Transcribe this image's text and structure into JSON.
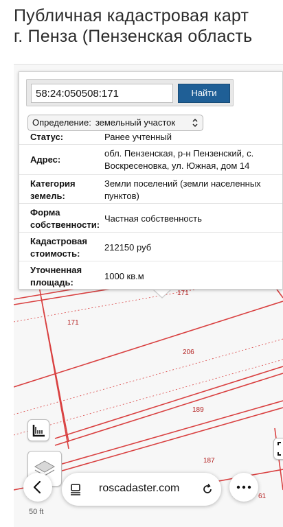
{
  "page": {
    "title_line1": "Публичная кадастровая карт",
    "title_line2": "г. Пенза (Пензенская область"
  },
  "search": {
    "value": "58:24:050508:171",
    "button_label": "Найти"
  },
  "definition": {
    "label": "Определение:",
    "selected": "земельный участок"
  },
  "info": {
    "status_label": "Статус:",
    "status_value": "Ранее учтенный",
    "address_label": "Адрес:",
    "address_value_line1": "обл. Пензенская, р-н Пензенский, с.",
    "address_value_line2": "Воскресеновка, ул. Южная, дом 14",
    "category_label_line1": "Категория",
    "category_label_line2": "земель:",
    "category_value_line1": "Земли поселений (земли населенных",
    "category_value_line2": "пунктов)",
    "ownership_label_line1": "Форма",
    "ownership_label_line2": "собственности:",
    "ownership_value": "Частная собственность",
    "cost_label_line1": "Кадастровая",
    "cost_label_line2": "стоимость:",
    "cost_value": "212150 руб",
    "area_label_line1": "Уточненная",
    "area_label_line2": "площадь:",
    "area_value": "1000 кв.м"
  },
  "map": {
    "parcel_labels": [
      "171",
      "171",
      "206",
      "189",
      "187",
      "61"
    ],
    "scale": "50 ft",
    "parcel_line_color": "#d94040"
  },
  "browser": {
    "url": "roscadaster.com"
  }
}
